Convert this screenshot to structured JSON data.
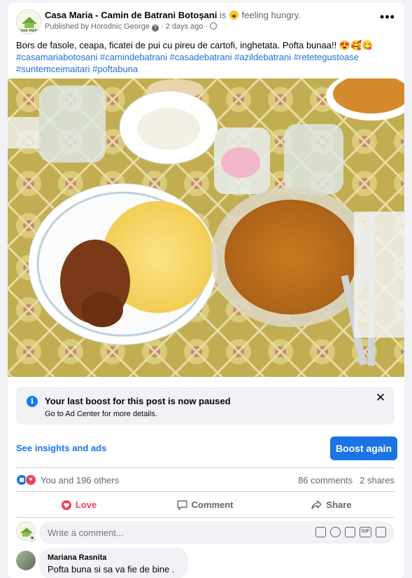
{
  "post": {
    "page_name": "Casa Maria - Camin de Batrani Botoșani",
    "is_text": " is ",
    "feeling": " feeling hungry.",
    "published_by": "Published by Horodnic George",
    "time_ago": "2 days ago",
    "text": "Bors de fasole, ceapa, ficatei de pui cu pireu de cartofi, inghetata. Pofta bunaa!! 😍🥰😋",
    "hashtags": "#casamariabotosani #camindebatrani #casadebatrani #azildebatrani #retetegustoase #suntemceimaitari #poftabuna",
    "avatar_text": "CASA MARIA",
    "more_label": "•••"
  },
  "boost": {
    "title": "Your last boost for this post is now paused",
    "subtitle": "Go to Ad Center for more details.",
    "close_label": "✕",
    "insights_label": "See insights and ads",
    "boost_again_label": "Boost again"
  },
  "engagement": {
    "reactions_text": "You and 196 others",
    "comments": "86 comments",
    "shares": "2 shares",
    "love_label": "Love",
    "comment_label": "Comment",
    "share_label": "Share"
  },
  "comment_box": {
    "placeholder": "Write a comment...",
    "gif_label": "GIF"
  },
  "comments": [
    {
      "author": "Mariana Rasnita",
      "text": "Pofta buna si sa va fie de bine ."
    }
  ],
  "colors": {
    "accent": "#1877f2",
    "love": "#f33e58",
    "muted": "#65676b"
  },
  "icons": [
    "feeling-hungry-icon",
    "info-icon",
    "globe-icon",
    "like-reaction-icon",
    "love-reaction-icon",
    "heart-icon",
    "comment-icon",
    "share-icon",
    "sticker-icon",
    "emoji-icon",
    "camera-icon",
    "gif-icon",
    "avatar-sticker-icon",
    "close-icon",
    "more-options-icon"
  ]
}
